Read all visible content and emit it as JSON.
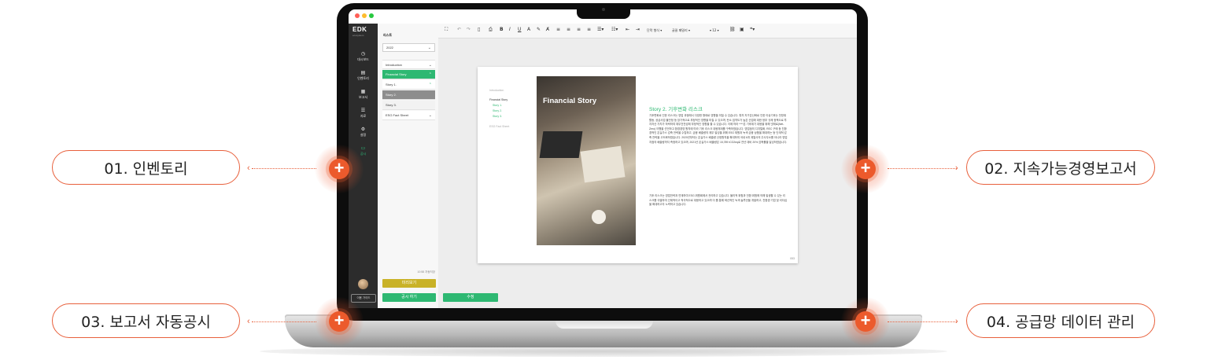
{
  "callouts": {
    "c1": "01. 인벤토리",
    "c2": "02. 지속가능경영보고서",
    "c3": "03. 보고서 자동공시",
    "c4": "04. 공급망 데이터 관리"
  },
  "plus_symbol": "+",
  "app": {
    "logo": "EDK",
    "logo_sub": "ecosystem",
    "nav": [
      {
        "icon": "◷",
        "label": "대시보드"
      },
      {
        "icon": "▤",
        "label": "인벤토리"
      },
      {
        "icon": "▦",
        "label": "보고서"
      },
      {
        "icon": "☰",
        "label": "자료"
      },
      {
        "icon": "⚙",
        "label": "설정"
      },
      {
        "icon": "▭",
        "label": "공시"
      }
    ],
    "user_button": "이용 가이드",
    "panel": {
      "title": "리스트",
      "year": "2022",
      "menu": [
        "Introduction",
        "Financial Story",
        "Story 1.",
        "Story 2.",
        "Story 3.",
        "ESG Fact Sheet"
      ],
      "footnote": "10:58 자동저장",
      "preview_button": "미리보기",
      "publish_button": "공시 하기",
      "edit_button": "수정"
    },
    "toolbar": {
      "format_select": "단락 형식",
      "font_select": "글꼴 패밀리",
      "size_select": "12"
    },
    "document": {
      "toc": [
        "Introduction",
        "Financial Story",
        "Story 1.",
        "Story 2.",
        "Story 3.",
        "ESG Fact Sheet"
      ],
      "photo_title": "Financial Story",
      "heading": "Story 2. 기후변화 리스크",
      "para1": "기후변화로 인한 리스크는 영업 과정에서 다양한 형태로 영향을 미칠 수 있습니다. 특히 지구온난화로 인한 이상기후는 전방위 활동, 공급사업 불안정 등 장기적으로 부정적인 영향을 미칠 수 있으며, 탄소 집약도가 높은 산업에 대한 정부 규제 정책으로 투자자산 가치가 하락하여 재무건전성에 부정적인 영향을 줄 수 있습니다. 이에 따라 ****은 기후위기 대응을 위해 넷제로(Net-Zero) 이행을 선언하고 환경경영 원칙에 따라 기후 리스크 대응체계를 구축하였습니다. 영업점의 디지털화, REC 구매 등 친환경적인 온실가스 감축 전략을 수립하고, 금융 배출량의 제무 발성을 위해 ESG 재원과 녹색 금융 상품을 확대하는 등 단계적 감축 전략을 고도화하였습니다. 2020년부터는 온실가스 배출량 산정원칙을 확대하여 국내 6개 계열사의 주사무소를 아니라 영업지점의 배출량까지 측정하고 있으며, 2021년 온실가스 배출량은 15,789 tCO2eq로 전년 대비 20% 감축률을 달성하였습니다.",
      "para2": "기후 리스크는 영업전략과 연계하여 ESG 위원회에서 관리하고 있습니다. 물리적 위험과 전환 위험에 의해 발생할 수 있는 리스크를 식별하여 선제적이고 적극적으로 대응하고 있으며 이 를 통해 혁신적인 녹색 솔루션을 개발하고, 친환경 기업 및 리더십을 확대하고자 노력하고 있습니다.",
      "page_num": "053"
    }
  }
}
